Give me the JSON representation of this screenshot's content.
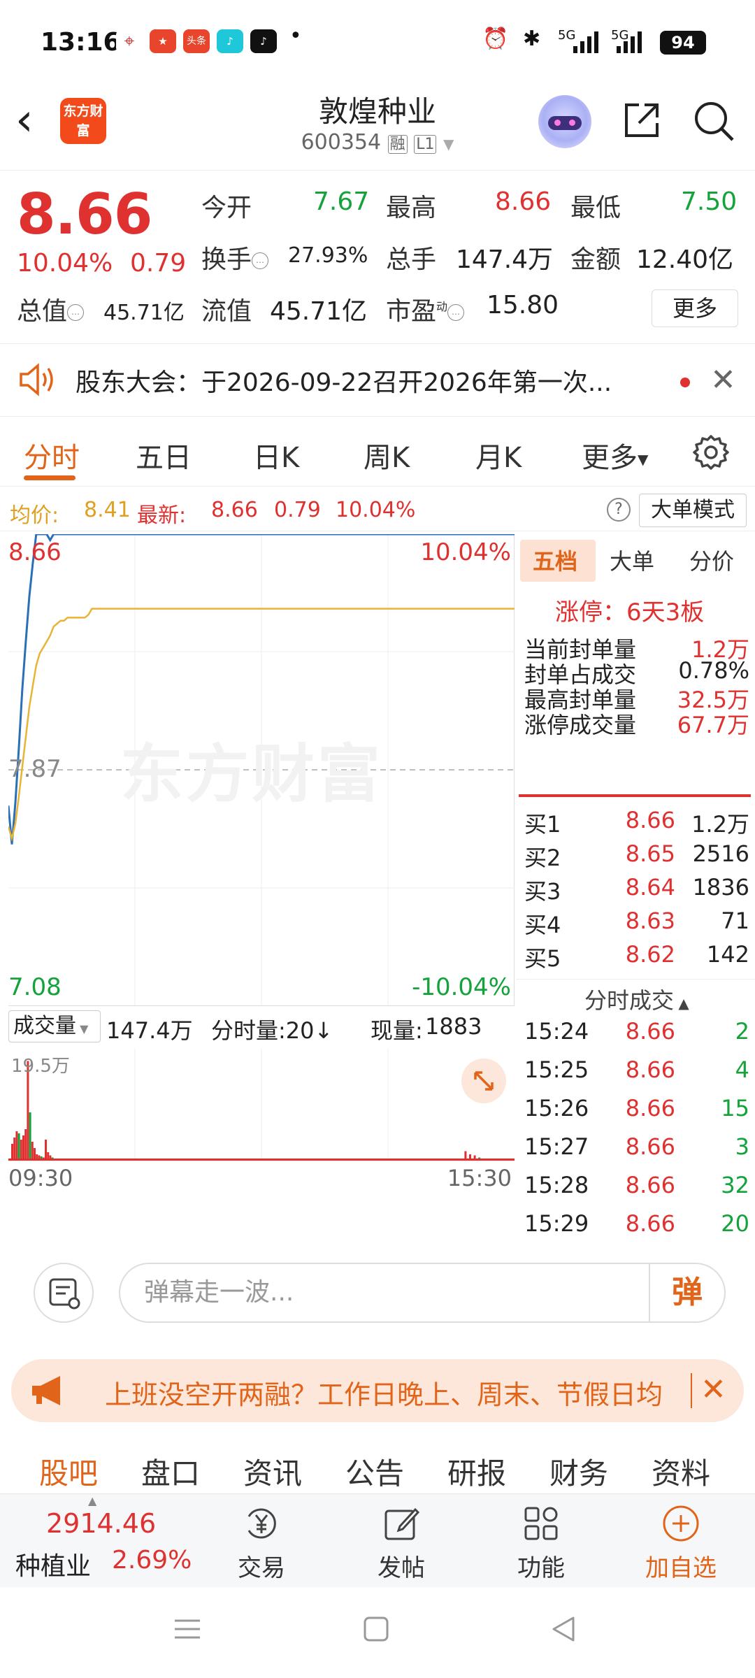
{
  "status_bar": {
    "time": "13:16",
    "battery": "94",
    "app_icons": [
      "map-pin-icon",
      "gov-app-icon",
      "toutiao-icon",
      "tiktok-lite-icon",
      "tiktok-icon"
    ],
    "toutiao_label": "头条",
    "more_dot": "•",
    "net1": "5G",
    "net2": "5G",
    "signal_icons": [
      "alarm-icon",
      "bluetooth-icon",
      "signal-icon"
    ]
  },
  "header": {
    "logo_text": "东方财富",
    "stock_name": "敦煌种业",
    "stock_code": "600354",
    "margin_badge": "融",
    "level_badge": "L1"
  },
  "quote": {
    "price": "8.66",
    "change_pct": "10.04%",
    "change_abs": "0.79",
    "open_label": "今开",
    "open": "7.67",
    "high_label": "最高",
    "high": "8.66",
    "low_label": "最低",
    "low": "7.50",
    "turnover_label": "换手",
    "turnover": "27.93%",
    "volume_label": "总手",
    "volume": "147.4万",
    "amount_label": "金额",
    "amount": "12.40亿",
    "mcap_label": "总值",
    "mcap": "45.71亿",
    "float_label": "流值",
    "float_cap": "45.71亿",
    "pe_label": "市盈",
    "pe_sup": "动",
    "pe": "15.80",
    "more_label": "更多",
    "colors": {
      "up": "#e03131",
      "down": "#14a33a"
    }
  },
  "notice": {
    "text": "股东大会：于2026-09-22召开2026年第一次..."
  },
  "tabs": [
    "分时",
    "五日",
    "日K",
    "周K",
    "月K"
  ],
  "tabs_more": "更多",
  "inforow": {
    "avg_label": "均价:",
    "avg": "8.41",
    "latest_label": "最新:",
    "latest": "8.66",
    "chg": "0.79",
    "pct": "10.04%",
    "mode_btn": "大单模式"
  },
  "chart": {
    "price_top": "8.66",
    "price_mid": "7.87",
    "price_bottom": "7.08",
    "pct_top": "10.04%",
    "pct_bottom": "-10.04%",
    "watermark": "东方财富",
    "time_start": "09:30",
    "time_end": "15:30"
  },
  "chart_data": {
    "type": "line",
    "ylim": [
      7.08,
      8.66
    ],
    "series": [
      {
        "values": [
          7.75,
          7.62,
          7.76,
          7.94,
          8.14,
          8.3,
          8.45,
          8.56,
          8.66,
          8.66,
          8.66,
          8.66,
          8.64,
          8.66,
          8.66,
          8.66,
          8.66,
          8.66,
          8.66,
          8.66,
          8.66,
          8.66,
          8.66,
          8.66,
          8.66
        ]
      },
      {
        "values": [
          7.68,
          7.64,
          7.69,
          7.78,
          7.88,
          7.98,
          8.08,
          8.15,
          8.22,
          8.26,
          8.28,
          8.3,
          8.32,
          8.35,
          8.36,
          8.37,
          8.37,
          8.38,
          8.38,
          8.38,
          8.38,
          8.38,
          8.38,
          8.39,
          8.41
        ]
      }
    ]
  },
  "volume": {
    "dropdown": "成交量",
    "total": "147.4万",
    "period_label": "分时量:20↓",
    "current_label": "现量:",
    "current": "1883",
    "max_label": "19.5万"
  },
  "volume_bars": [
    0.16,
    0.22,
    0.28,
    0.26,
    0.2,
    0.24,
    0.3,
    0.95,
    0.46,
    0.18,
    0.12,
    0.06,
    0.05,
    0.04,
    0.03,
    0.2,
    0.08,
    0.05,
    0.03,
    0.02,
    0.02,
    0.02,
    0.01,
    0.01,
    0.01,
    0.01,
    0.01,
    0.01,
    0.01,
    0.01,
    0.01,
    0.01,
    0.01,
    0.01,
    0.01,
    0.01,
    0.01,
    0.01,
    0.01,
    0.01,
    0.09,
    0.06,
    0.05,
    0.03,
    0.02,
    0.02,
    0.02,
    0.02,
    0.02,
    0.02
  ],
  "right_panel": {
    "tabs": [
      "五档",
      "大单",
      "分价"
    ],
    "limit_up": "涨停：6天3板",
    "stats": [
      {
        "label": "当前封单量",
        "value": "1.2万",
        "color": "red"
      },
      {
        "label": "封单占成交",
        "value": "0.78%",
        "color": "dark"
      },
      {
        "label": "最高封单量",
        "value": "32.5万",
        "color": "red"
      },
      {
        "label": "涨停成交量",
        "value": "67.7万",
        "color": "red"
      }
    ],
    "bids": [
      {
        "label": "买1",
        "price": "8.66",
        "vol": "1.2万"
      },
      {
        "label": "买2",
        "price": "8.65",
        "vol": "2516"
      },
      {
        "label": "买3",
        "price": "8.64",
        "vol": "1836"
      },
      {
        "label": "买4",
        "price": "8.63",
        "vol": "71"
      },
      {
        "label": "买5",
        "price": "8.62",
        "vol": "142"
      }
    ],
    "trades_header": "分时成交",
    "trades": [
      {
        "time": "15:24",
        "price": "8.66",
        "vol": "2"
      },
      {
        "time": "15:25",
        "price": "8.66",
        "vol": "4"
      },
      {
        "time": "15:26",
        "price": "8.66",
        "vol": "15"
      },
      {
        "time": "15:27",
        "price": "8.66",
        "vol": "3"
      },
      {
        "time": "15:28",
        "price": "8.66",
        "vol": "32"
      },
      {
        "time": "15:29",
        "price": "8.66",
        "vol": "20"
      }
    ]
  },
  "danmu": {
    "placeholder": "弹幕走一波...",
    "button": "弹"
  },
  "promo": {
    "text": "上班没空开两融？工作日晚上、周末、节假日均"
  },
  "bottom_tabs": [
    "股吧",
    "盘口",
    "资讯",
    "公告",
    "研报",
    "财务",
    "资料"
  ],
  "bottom_nav": {
    "index": "2914.46",
    "sector": "种植业",
    "sector_pct": "2.69%",
    "items": [
      "交易",
      "发帖",
      "功能",
      "加自选"
    ]
  }
}
